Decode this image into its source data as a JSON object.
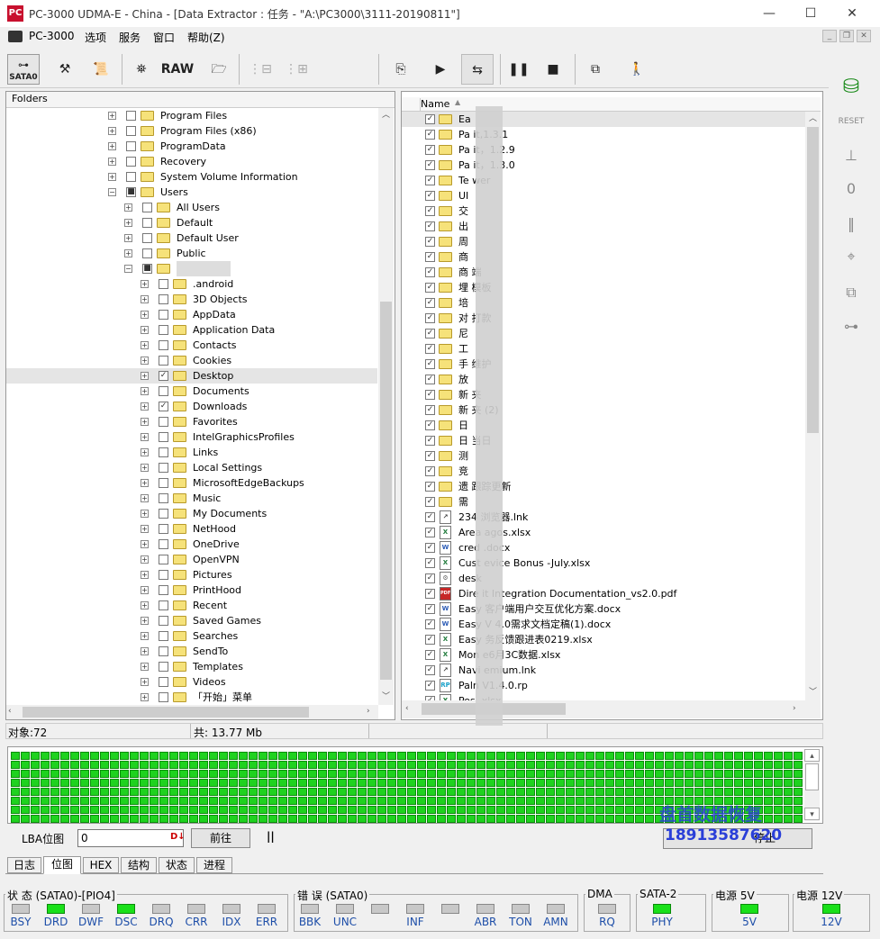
{
  "window": {
    "title": "PC-3000 UDMA-E - China - [Data Extractor : 任务 - \"A:\\PC3000\\3111-20190811\"]",
    "app_icon": "PC"
  },
  "menu": [
    "PC-3000",
    "选项",
    "服务",
    "窗口",
    "帮助(Z)"
  ],
  "toolbar": {
    "sata_label": "SATA0",
    "raw_label": "RAW"
  },
  "folders": {
    "header": "Folders",
    "items": [
      {
        "label": "Program Files",
        "level": 0,
        "exp": "+",
        "check": ""
      },
      {
        "label": "Program Files (x86)",
        "level": 0,
        "exp": "+",
        "check": ""
      },
      {
        "label": "ProgramData",
        "level": 0,
        "exp": "+",
        "check": ""
      },
      {
        "label": "Recovery",
        "level": 0,
        "exp": "+",
        "check": ""
      },
      {
        "label": "System Volume Information",
        "level": 0,
        "exp": "+",
        "check": ""
      },
      {
        "label": "Users",
        "level": 0,
        "exp": "−",
        "check": "■"
      },
      {
        "label": "All Users",
        "level": 1,
        "exp": "+",
        "check": ""
      },
      {
        "label": "Default",
        "level": 1,
        "exp": "+",
        "check": ""
      },
      {
        "label": "Default User",
        "level": 1,
        "exp": "+",
        "check": ""
      },
      {
        "label": "Public",
        "level": 1,
        "exp": "+",
        "check": ""
      },
      {
        "label": "",
        "level": 1,
        "exp": "−",
        "check": "■"
      },
      {
        "label": ".android",
        "level": 2,
        "exp": "+",
        "check": ""
      },
      {
        "label": "3D Objects",
        "level": 2,
        "exp": "+",
        "check": ""
      },
      {
        "label": "AppData",
        "level": 2,
        "exp": "+",
        "check": ""
      },
      {
        "label": "Application Data",
        "level": 2,
        "exp": "+",
        "check": ""
      },
      {
        "label": "Contacts",
        "level": 2,
        "exp": "+",
        "check": ""
      },
      {
        "label": "Cookies",
        "level": 2,
        "exp": "+",
        "check": ""
      },
      {
        "label": "Desktop",
        "level": 2,
        "exp": "+",
        "check": "✓"
      },
      {
        "label": "Documents",
        "level": 2,
        "exp": "+",
        "check": ""
      },
      {
        "label": "Downloads",
        "level": 2,
        "exp": "+",
        "check": "✓"
      },
      {
        "label": "Favorites",
        "level": 2,
        "exp": "+",
        "check": ""
      },
      {
        "label": "IntelGraphicsProfiles",
        "level": 2,
        "exp": "+",
        "check": ""
      },
      {
        "label": "Links",
        "level": 2,
        "exp": "+",
        "check": ""
      },
      {
        "label": "Local Settings",
        "level": 2,
        "exp": "+",
        "check": ""
      },
      {
        "label": "MicrosoftEdgeBackups",
        "level": 2,
        "exp": "+",
        "check": ""
      },
      {
        "label": "Music",
        "level": 2,
        "exp": "+",
        "check": ""
      },
      {
        "label": "My Documents",
        "level": 2,
        "exp": "+",
        "check": ""
      },
      {
        "label": "NetHood",
        "level": 2,
        "exp": "+",
        "check": ""
      },
      {
        "label": "OneDrive",
        "level": 2,
        "exp": "+",
        "check": ""
      },
      {
        "label": "OpenVPN",
        "level": 2,
        "exp": "+",
        "check": ""
      },
      {
        "label": "Pictures",
        "level": 2,
        "exp": "+",
        "check": ""
      },
      {
        "label": "PrintHood",
        "level": 2,
        "exp": "+",
        "check": ""
      },
      {
        "label": "Recent",
        "level": 2,
        "exp": "+",
        "check": ""
      },
      {
        "label": "Saved Games",
        "level": 2,
        "exp": "+",
        "check": ""
      },
      {
        "label": "Searches",
        "level": 2,
        "exp": "+",
        "check": ""
      },
      {
        "label": "SendTo",
        "level": 2,
        "exp": "+",
        "check": ""
      },
      {
        "label": "Templates",
        "level": 2,
        "exp": "+",
        "check": ""
      },
      {
        "label": "Videos",
        "level": 2,
        "exp": "+",
        "check": ""
      },
      {
        "label": "「开始」菜单",
        "level": 2,
        "exp": "+",
        "check": ""
      }
    ]
  },
  "files": {
    "header": "Name",
    "items": [
      {
        "label": "Ea",
        "icon": "folder"
      },
      {
        "label": "Pa        it,1.3.1",
        "icon": "folder"
      },
      {
        "label": "Pa        it，1.2.9",
        "icon": "folder"
      },
      {
        "label": "Pa        it，1.3.0",
        "icon": "folder"
      },
      {
        "label": "Te        wer",
        "icon": "folder"
      },
      {
        "label": "UI",
        "icon": "folder"
      },
      {
        "label": "交",
        "icon": "folder"
      },
      {
        "label": "出",
        "icon": "folder"
      },
      {
        "label": "周",
        "icon": "folder"
      },
      {
        "label": "商",
        "icon": "folder"
      },
      {
        "label": "商        端",
        "icon": "folder"
      },
      {
        "label": "埋        模板",
        "icon": "folder"
      },
      {
        "label": "培",
        "icon": "folder"
      },
      {
        "label": "对        打款",
        "icon": "folder"
      },
      {
        "label": "尼",
        "icon": "folder"
      },
      {
        "label": "工",
        "icon": "folder"
      },
      {
        "label": "手        维护",
        "icon": "folder"
      },
      {
        "label": "放",
        "icon": "folder"
      },
      {
        "label": "新        夹",
        "icon": "folder"
      },
      {
        "label": "新        夹 (2)",
        "icon": "folder"
      },
      {
        "label": "日",
        "icon": "folder"
      },
      {
        "label": "日        当日",
        "icon": "folder"
      },
      {
        "label": "测",
        "icon": "folder"
      },
      {
        "label": "竞",
        "icon": "folder"
      },
      {
        "label": "遗        跟踪更新",
        "icon": "folder"
      },
      {
        "label": "需",
        "icon": "folder"
      },
      {
        "label": "234        浏览器.lnk",
        "icon": "lnk"
      },
      {
        "label": "Area        agos.xlsx",
        "icon": "xlsx"
      },
      {
        "label": "cred        .docx",
        "icon": "docx"
      },
      {
        "label": "Cust        evice Bonus -July.xlsx",
        "icon": "xlsx"
      },
      {
        "label": "desk",
        "icon": "ini"
      },
      {
        "label": "Dire        it Integration Documentation_vs2.0.pdf",
        "icon": "pdf"
      },
      {
        "label": "Easy        客户端用户交互优化方案.docx",
        "icon": "docx"
      },
      {
        "label": "Easy        V 4.0需求文档定稿(1).docx",
        "icon": "docx"
      },
      {
        "label": "Easy        务反馈跟进表0219.xlsx",
        "icon": "xlsx"
      },
      {
        "label": "Mon        e6月3C数据.xlsx",
        "icon": "xlsx"
      },
      {
        "label": "Navi        emium.lnk",
        "icon": "lnk"
      },
      {
        "label": "Paln        V1.4.0.rp",
        "icon": "rp"
      },
      {
        "label": "Pos        .xlsx",
        "icon": "xlsx"
      }
    ]
  },
  "status": {
    "objects": "对象:72",
    "total": "共: 13.77 Mb"
  },
  "lba": {
    "label": "LBA位图",
    "value": "0",
    "go_label": "前往",
    "pause": "||",
    "stop_label": "停止"
  },
  "watermark": {
    "line1": "盘首数据恢复",
    "line2": "18913587620"
  },
  "tabs": [
    "日志",
    "位图",
    "HEX",
    "结构",
    "状态",
    "进程"
  ],
  "active_tab": 1,
  "indicators": {
    "status_group": "状 态 (SATA0)-[PIO4]",
    "error_group": "错 误 (SATA0)",
    "dma_group": "DMA",
    "sata_group": "SATA-2",
    "p5_group": "电源 5V",
    "p12_group": "电源 12V",
    "status": [
      {
        "name": "BSY",
        "on": false
      },
      {
        "name": "DRD",
        "on": true
      },
      {
        "name": "DWF",
        "on": false
      },
      {
        "name": "DSC",
        "on": true
      },
      {
        "name": "DRQ",
        "on": false
      },
      {
        "name": "CRR",
        "on": false
      },
      {
        "name": "IDX",
        "on": false
      },
      {
        "name": "ERR",
        "on": false
      }
    ],
    "errors": [
      {
        "name": "BBK",
        "on": false
      },
      {
        "name": "UNC",
        "on": false
      },
      {
        "name": "",
        "on": false
      },
      {
        "name": "INF",
        "on": false
      },
      {
        "name": "",
        "on": false
      },
      {
        "name": "ABR",
        "on": false
      },
      {
        "name": "TON",
        "on": false
      },
      {
        "name": "AMN",
        "on": false
      }
    ],
    "dma": {
      "name": "RQ",
      "on": false
    },
    "sata": {
      "name": "PHY",
      "on": true
    },
    "p5": {
      "name": "5V",
      "on": true
    },
    "p12": {
      "name": "12V",
      "on": true
    }
  },
  "colors": {
    "led_on": "#19e019",
    "led_off": "#c8c8c8",
    "block_ok": "#1fd21f",
    "watermark": "#2a3fd8"
  }
}
